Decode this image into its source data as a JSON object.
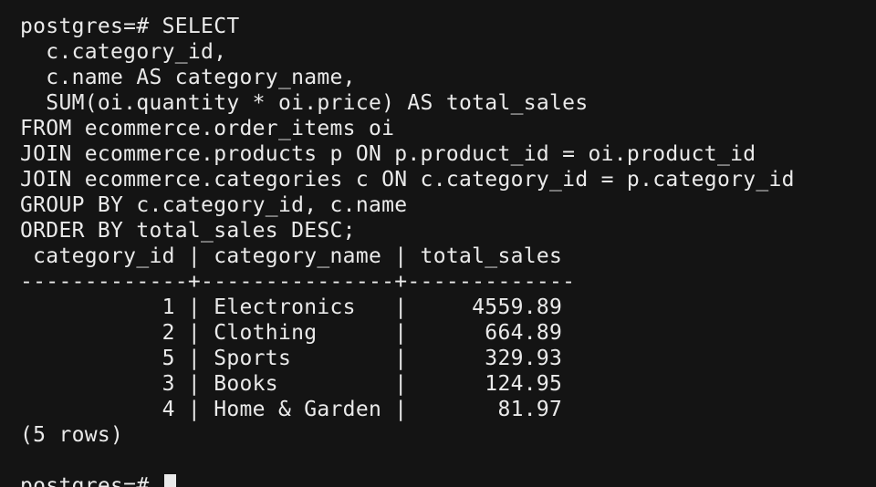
{
  "terminal": {
    "prompt": "postgres=# ",
    "query_lines": [
      "postgres=# SELECT",
      "  c.category_id,",
      "  c.name AS category_name,",
      "  SUM(oi.quantity * oi.price) AS total_sales",
      "FROM ecommerce.order_items oi",
      "JOIN ecommerce.products p ON p.product_id = oi.product_id",
      "JOIN ecommerce.categories c ON c.category_id = p.category_id",
      "GROUP BY c.category_id, c.name",
      "ORDER BY total_sales DESC;"
    ],
    "result": {
      "header": " category_id | category_name | total_sales",
      "separator": "-------------+---------------+-------------",
      "columns": [
        "category_id",
        "category_name",
        "total_sales"
      ],
      "rows": [
        {
          "category_id": "1",
          "category_name": "Electronics",
          "total_sales": "4559.89",
          "text": "           1 | Electronics   |     4559.89"
        },
        {
          "category_id": "2",
          "category_name": "Clothing",
          "total_sales": "664.89",
          "text": "           2 | Clothing      |      664.89"
        },
        {
          "category_id": "5",
          "category_name": "Sports",
          "total_sales": "329.93",
          "text": "           5 | Sports        |      329.93"
        },
        {
          "category_id": "3",
          "category_name": "Books",
          "total_sales": "124.95",
          "text": "           3 | Books         |      124.95"
        },
        {
          "category_id": "4",
          "category_name": "Home & Garden",
          "total_sales": "81.97",
          "text": "           4 | Home & Garden |       81.97"
        }
      ],
      "row_count": "(5 rows)"
    },
    "blank": ""
  }
}
